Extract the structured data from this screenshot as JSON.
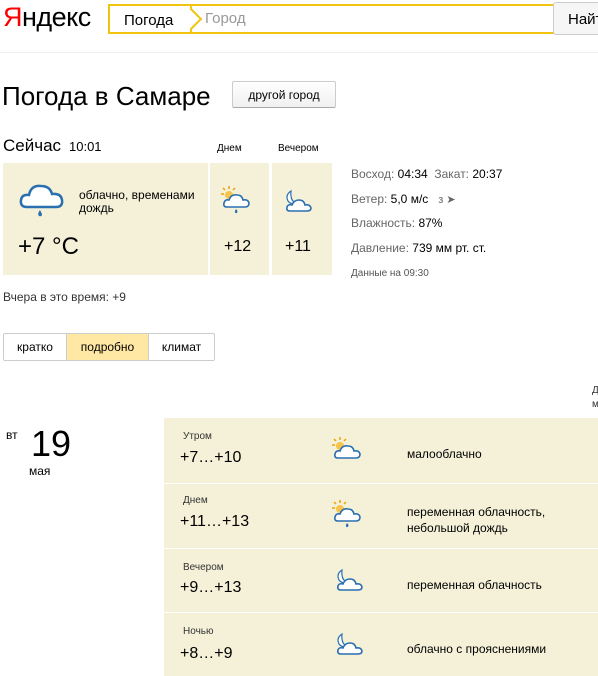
{
  "header": {
    "logo_part1": "Я",
    "logo_part2": "ндекс",
    "search_tab": "Погода",
    "search_placeholder": "Город",
    "find_button": "Найт"
  },
  "title": "Погода в Самаре",
  "other_city_button": "другой город",
  "now": {
    "label": "Сейчас",
    "time": "10:01",
    "description": "облачно, временами дождь",
    "temp": "+7 °C"
  },
  "columns": {
    "day": "Днем",
    "evening": "Вечером"
  },
  "day_temp": "+12",
  "evening_temp": "+11",
  "details": {
    "sunrise_label": "Восход:",
    "sunrise": "04:34",
    "sunset_label": "Закат:",
    "sunset": "20:37",
    "wind_label": "Ветер:",
    "wind": "5,0 м/с",
    "wind_dir": "з ➤",
    "humidity_label": "Влажность:",
    "humidity": "87%",
    "pressure_label": "Давление:",
    "pressure": "739 мм рт. ст.",
    "data_time": "Данные на 09:30"
  },
  "yesterday": "Вчера в это время: +9",
  "tabs": {
    "short": "кратко",
    "detailed": "подробно",
    "climate": "климат"
  },
  "right_cut": "Д\nм",
  "date": {
    "weekday": "вт",
    "day": "19",
    "month": "мая"
  },
  "forecast": [
    {
      "part": "Утром",
      "temp": "+7…+10",
      "desc": "малооблачно"
    },
    {
      "part": "Днем",
      "temp": "+11…+13",
      "desc": "переменная облачность, небольшой дождь"
    },
    {
      "part": "Вечером",
      "temp": "+9…+13",
      "desc": "переменная облачность"
    },
    {
      "part": "Ночью",
      "temp": "+8…+9",
      "desc": "облачно с прояснениями"
    }
  ]
}
